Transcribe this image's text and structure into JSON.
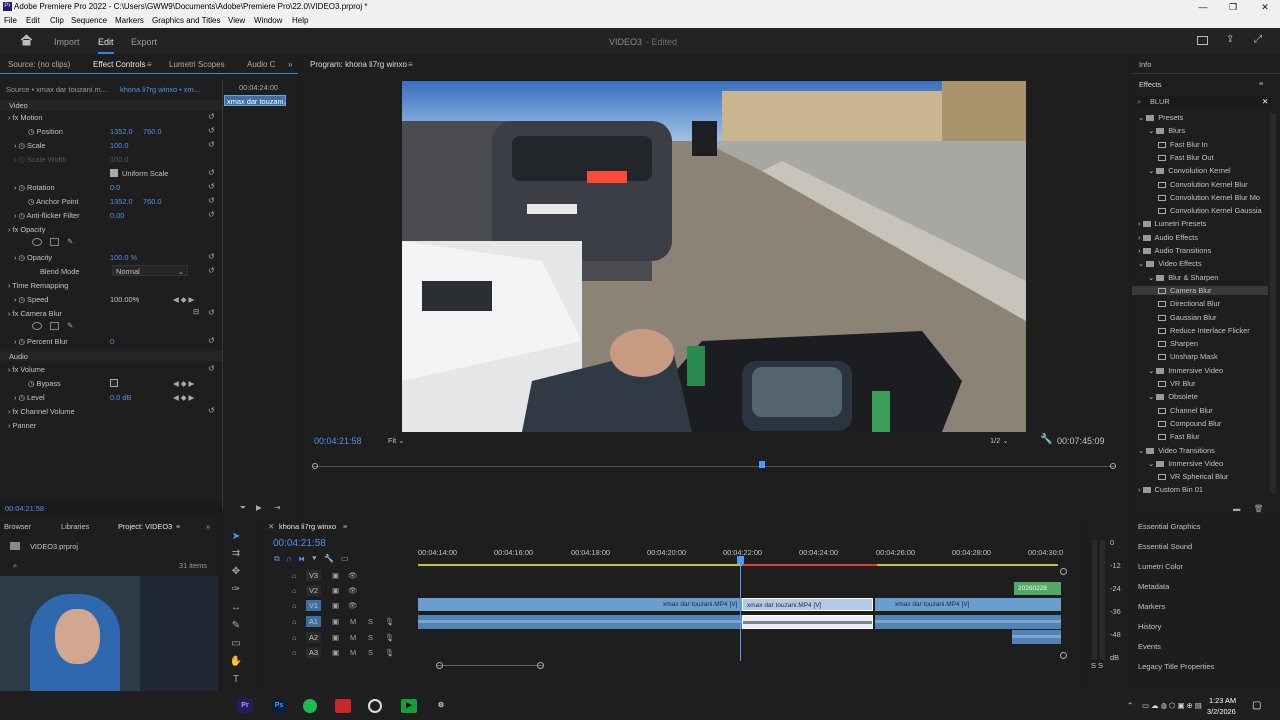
{
  "window": {
    "title": "Adobe Premiere Pro 2022 - C:\\Users\\GWW9\\Documents\\Adobe\\Premiere Pro\\22.0\\VIDEO3.prproj *",
    "min": "—",
    "restore": "❐",
    "close": "✕"
  },
  "menu": [
    "File",
    "Edit",
    "Clip",
    "Sequence",
    "Markers",
    "Graphics and Titles",
    "View",
    "Window",
    "Help"
  ],
  "workspace": {
    "tabs": [
      "Import",
      "Edit",
      "Export"
    ],
    "active": "Edit",
    "project_title": "VIDEO3",
    "status": "- Edited"
  },
  "effect_controls": {
    "tabs": [
      "Source: (no clips)",
      "Effect Controls",
      "Lumetri Scopes",
      "Audio C"
    ],
    "source_label": "Source • xmax dar touzani.m...",
    "sequence_label": "khona li7rg winxo • xm...",
    "timecode_top": "00:04:24:00",
    "clip_label": "xmax dar touzani.",
    "video_header": "Video",
    "audio_header": "Audio",
    "motion": "Motion",
    "position_label": "Position",
    "position_x": "1352.0",
    "position_y": "760.0",
    "scale_label": "Scale",
    "scale_value": "100.0",
    "scale_width_label": "Scale Width",
    "scale_width_value": "100.0",
    "uniform_scale": "Uniform Scale",
    "rotation_label": "Rotation",
    "rotation_value": "0.0",
    "anchor_label": "Anchor Point",
    "anchor_x": "1352.0",
    "anchor_y": "760.0",
    "antiflicker_label": "Anti-flicker Filter",
    "antiflicker_value": "0.00",
    "opacity": "Opacity",
    "opacity_label": "Opacity",
    "opacity_value": "100.0 %",
    "blend_label": "Blend Mode",
    "blend_value": "Normal",
    "time_remap": "Time Remapping",
    "speed_label": "Speed",
    "speed_value": "100.00%",
    "camera_blur": "Camera Blur",
    "percent_blur_label": "Percent Blur",
    "percent_blur_value": "0",
    "volume": "Volume",
    "bypass_label": "Bypass",
    "level_label": "Level",
    "level_value": "0.0 dB",
    "channel_volume": "Channel Volume",
    "panner": "Panner",
    "timecode_bottom": "00:04:21:58"
  },
  "program": {
    "title": "Program: khona li7rg winxo",
    "timecode": "00:04:21:58",
    "fit": "Fit",
    "quality": "1/2",
    "duration": "00:07:45:09",
    "playhead_fraction": 0.56
  },
  "effects": {
    "info_tab": "Info",
    "effects_tab": "Effects",
    "search_value": "BLUR",
    "tree": [
      {
        "label": "Presets",
        "level": 0,
        "type": "folder",
        "open": true
      },
      {
        "label": "Blurs",
        "level": 1,
        "type": "folder",
        "open": true
      },
      {
        "label": "Fast Blur In",
        "level": 2,
        "type": "fx"
      },
      {
        "label": "Fast Blur Out",
        "level": 2,
        "type": "fx"
      },
      {
        "label": "Convolution Kernel",
        "level": 1,
        "type": "folder",
        "open": true
      },
      {
        "label": "Convolution Kernel Blur",
        "level": 2,
        "type": "fx"
      },
      {
        "label": "Convolution Kernel Blur Mo",
        "level": 2,
        "type": "fx"
      },
      {
        "label": "Convolution Kernel Gaussia",
        "level": 2,
        "type": "fx"
      },
      {
        "label": "Lumetri Presets",
        "level": 0,
        "type": "folder",
        "open": false
      },
      {
        "label": "Audio Effects",
        "level": 0,
        "type": "folder",
        "open": false
      },
      {
        "label": "Audio Transitions",
        "level": 0,
        "type": "folder",
        "open": false
      },
      {
        "label": "Video Effects",
        "level": 0,
        "type": "folder",
        "open": true
      },
      {
        "label": "Blur & Sharpen",
        "level": 1,
        "type": "folder",
        "open": true
      },
      {
        "label": "Camera Blur",
        "level": 2,
        "type": "fx",
        "selected": true
      },
      {
        "label": "Directional Blur",
        "level": 2,
        "type": "fx"
      },
      {
        "label": "Gaussian Blur",
        "level": 2,
        "type": "fx"
      },
      {
        "label": "Reduce Interlace Flicker",
        "level": 2,
        "type": "fx"
      },
      {
        "label": "Sharpen",
        "level": 2,
        "type": "fx"
      },
      {
        "label": "Unsharp Mask",
        "level": 2,
        "type": "fx"
      },
      {
        "label": "Immersive Video",
        "level": 1,
        "type": "folder",
        "open": true
      },
      {
        "label": "VR Blur",
        "level": 2,
        "type": "fx"
      },
      {
        "label": "Obsolete",
        "level": 1,
        "type": "folder",
        "open": true
      },
      {
        "label": "Channel Blur",
        "level": 2,
        "type": "fx"
      },
      {
        "label": "Compound Blur",
        "level": 2,
        "type": "fx"
      },
      {
        "label": "Fast Blur",
        "level": 2,
        "type": "fx"
      },
      {
        "label": "Video Transitions",
        "level": 0,
        "type": "folder",
        "open": true
      },
      {
        "label": "Immersive Video",
        "level": 1,
        "type": "folder",
        "open": true
      },
      {
        "label": "VR Spherical Blur",
        "level": 2,
        "type": "fx"
      },
      {
        "label": "Custom Bin 01",
        "level": 0,
        "type": "folder",
        "open": false
      }
    ],
    "panels": [
      "Essential Graphics",
      "Essential Sound",
      "Lumetri Color",
      "Metadata",
      "Markers",
      "History",
      "Events",
      "Legacy Title Properties"
    ]
  },
  "project": {
    "tabs": [
      "Browser",
      "Libraries",
      "Project: VIDEO3"
    ],
    "file": "VIDEO3.prproj",
    "items": "31 items"
  },
  "timeline": {
    "tab": "khona li7rg winxo",
    "timecode": "00:04:21:58",
    "ruler": [
      "00:04:14:00",
      "00:04:16:00",
      "00:04:18:00",
      "00:04:20:00",
      "00:04:22:00",
      "00:04:24:00",
      "00:04:26:00",
      "00:04:28:00",
      "00:04:30:0"
    ],
    "tracks_v": [
      "V3",
      "V2",
      "V1"
    ],
    "tracks_a": [
      "A1",
      "A2",
      "A3"
    ],
    "clip1": "xmax dar touzani.MP4 [V]",
    "clip2": "xmax dar touzani.MP4 [V]",
    "clip3": "xmax dar touzani.MP4 [V]",
    "clip_v2": "20260228",
    "meter_labels": [
      "0",
      "-12",
      "-24",
      "-36",
      "-48",
      "dB"
    ],
    "meter_ss": "S  S"
  },
  "taskbar": {
    "time": "1:23 AM",
    "date": "3/2/2026"
  }
}
